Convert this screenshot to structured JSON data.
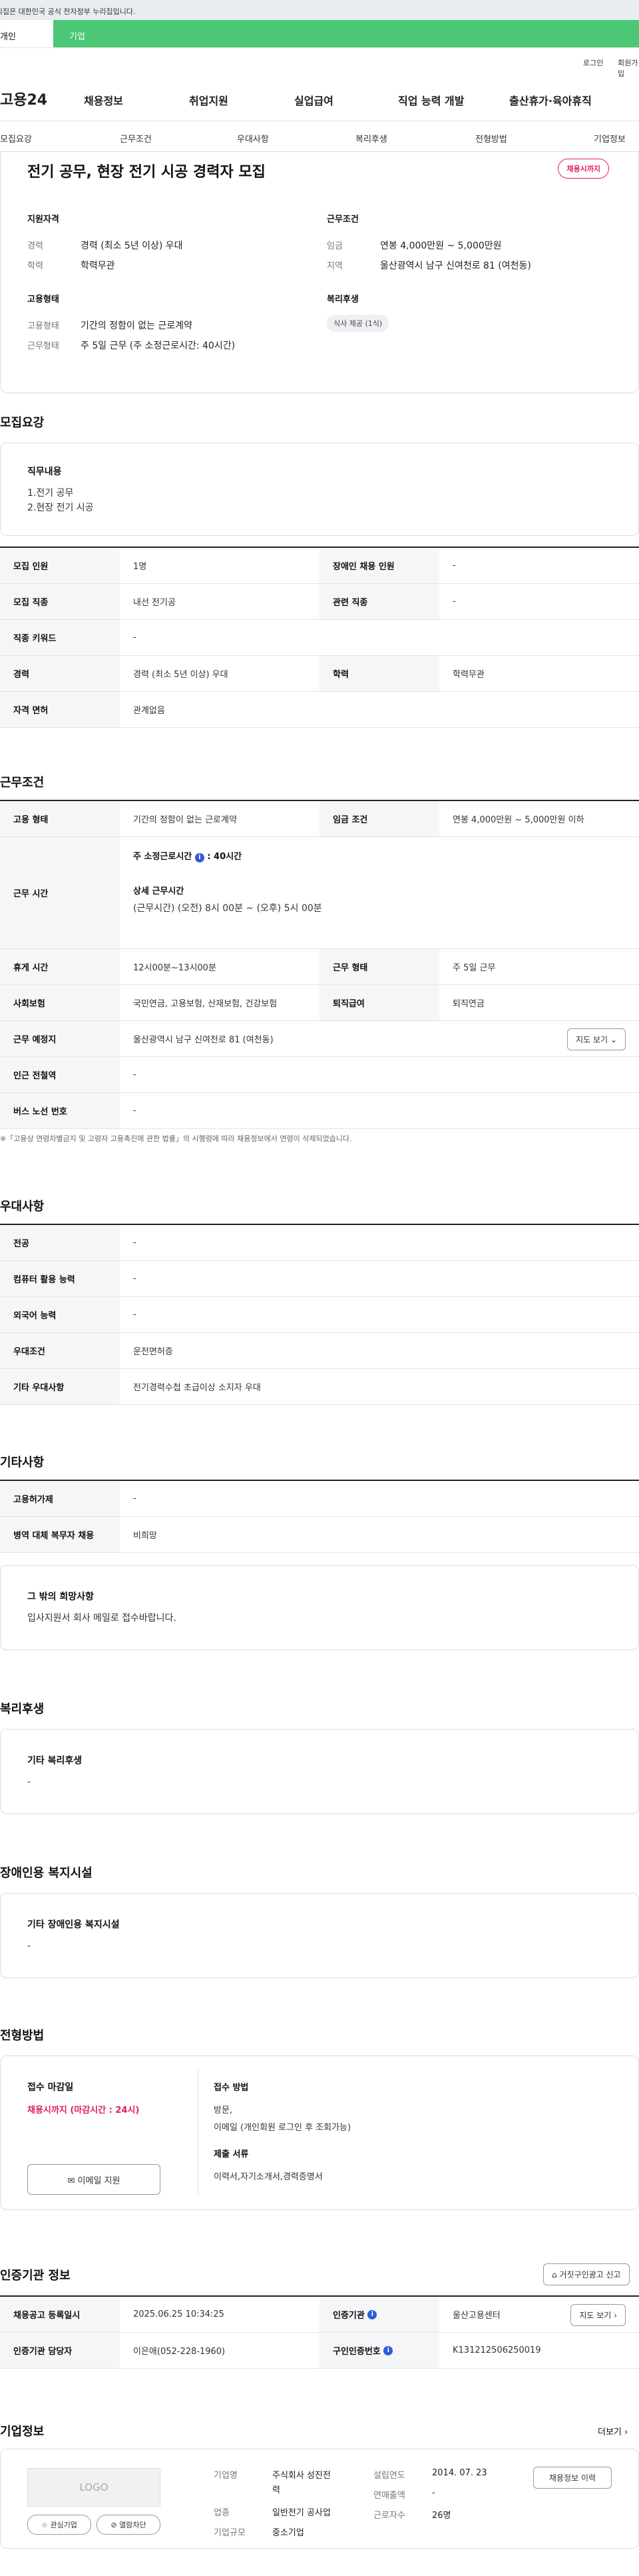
{
  "notice": "이 누리집은 대한민국 공식 전자정부 누리집입니다.",
  "usertabs": [
    "개인",
    "기업"
  ],
  "util": [
    "로그인",
    "회원가입"
  ],
  "gnb": {
    "logo": "고용24",
    "menu": [
      "채용정보",
      "취업지원",
      "실업급여",
      "직업 능력 개발",
      "출산휴가·육아휴직"
    ]
  },
  "tabs": [
    "모집요강",
    "근무조건",
    "우대사항",
    "복리후생",
    "전형방법",
    "기업정보"
  ],
  "job": {
    "title": "전기 공무, 현장 전기 시공 경력자 모집",
    "badge": "채용시까지",
    "req_title": "지원자격",
    "req_k": [
      "경력",
      "학력"
    ],
    "req_v": [
      "경력 (최소 5년 이상) 우대",
      "학력무관"
    ],
    "cond_title": "근무조건",
    "cond_k": [
      "임금",
      "지역"
    ],
    "cond_v": [
      "연봉 4,000만원 ~ 5,000만원",
      "울산광역시 남구 신여천로 81 (여천동)"
    ],
    "emp_title": "고용형태",
    "emp_k": [
      "고용형태",
      "근무형태"
    ],
    "emp_v": [
      "기간의 정함이 없는 근로계약",
      "주 5일 근무 (주 소정근로시간: 40시간)"
    ],
    "welfare_title": "복리후생",
    "welfare_tag": "식사 제공 (1식)"
  },
  "s1": {
    "title": "모집요강",
    "box_title": "직무내용",
    "box_lines": [
      "1.전기 공무",
      "2.현장 전기 시공"
    ],
    "rows": [
      [
        "모집 인원",
        "1명",
        "장애인 채용 인원",
        "-"
      ],
      [
        "모집 직종",
        "내선 전기공",
        "관련 직종",
        "-"
      ],
      [
        "직종 키워드",
        "-"
      ],
      [
        "경력",
        "경력 (최소 5년 이상) 우대",
        "학력",
        "학력무관"
      ],
      [
        "자격 면허",
        "관계없음"
      ]
    ]
  },
  "s2": {
    "title": "근무조건",
    "r1": [
      "고용 형태",
      "기간의 정함이 없는 근로계약",
      "임금 조건",
      "연봉 4,000만원 ~ 5,000만원 이하"
    ],
    "time_k": "근무 시간",
    "time_a": "주 소정근로시간",
    "time_b": "40시간",
    "time_c": "상세 근무시간",
    "time_d": "(근무시간) (오전) 8시 00분 ~ (오후) 5시 00분",
    "rows": [
      [
        "휴게 시간",
        "12시00분~13시00분",
        "근무 형태",
        "주 5일 근무"
      ],
      [
        "사회보험",
        "국민연금, 고용보험, 산재보험, 건강보험",
        "퇴직급여",
        "퇴직연금"
      ]
    ],
    "place": [
      "근무 예정지",
      "울산광역시 남구 신여천로 81 (여천동)"
    ],
    "map_btn": "지도 보기",
    "rows2": [
      [
        "인근 전철역",
        "-"
      ],
      [
        "버스 노선 번호",
        "-"
      ]
    ],
    "note": "※「고용상 연령차별금지 및 고령자 고용촉진에 관한 법률」의 시행령에 따라 채용정보에서 연령이 삭제되었습니다."
  },
  "s3": {
    "title": "우대사항",
    "rows": [
      [
        "전공",
        "-"
      ],
      [
        "컴퓨터 활용 능력",
        "-"
      ],
      [
        "외국어 능력",
        "-"
      ],
      [
        "우대조건",
        "운전면허증"
      ],
      [
        "기타 우대사항",
        "전기경력수첩 초급이상 소지자 우대"
      ]
    ]
  },
  "s4": {
    "title": "기타사항",
    "rows": [
      [
        "고용허가제",
        "-"
      ],
      [
        "병역 대체 복무자 채용",
        "비희망"
      ]
    ],
    "box_title": "그 밖의 희망사항",
    "box_text": "입사지원서 회사 메일로 접수바랍니다."
  },
  "s5": {
    "title": "복리후생",
    "box_title": "기타 복리후생",
    "box_text": "-"
  },
  "s6": {
    "title": "장애인용 복지시설",
    "box_title": "기타 장애인용 복지시설",
    "box_text": "-"
  },
  "s7": {
    "title": "전형방법",
    "deadline_k": "접수 마감일",
    "deadline_v": "채용시까지 (마감시간 : 24시)",
    "email_btn": "이메일 지원",
    "method_k": "접수 방법",
    "method_v1": "방문,",
    "method_v2": "이메일 (개인회원 로그인 후 조회가능)",
    "docs_k": "제출 서류",
    "docs_v": "이력서,자기소개서,경력증명서"
  },
  "s8": {
    "title": "인증기관 정보",
    "report": "거짓구인광고 신고",
    "r1": [
      "채용공고 등록일시",
      "2025.06.25 10:34:25",
      "인증기관",
      "울산고용센터"
    ],
    "map_btn": "지도 보기",
    "r2": [
      "인증기관 담당자",
      "이은애(052-228-1960)",
      "구인인증번호",
      "K131212506250019"
    ]
  },
  "s9": {
    "title": "기업정보",
    "more": "더보기",
    "logo": "LOGO",
    "fav": "관심기업",
    "block": "열람차단",
    "k1": "기업명",
    "v1a": "주식회사 성진전",
    "v1b": "력",
    "k2": "업종",
    "v2": "일반전기 공사업",
    "k3": "기업규모",
    "v3": "중소기업",
    "k4": "설립연도",
    "v4": "2014. 07. 23",
    "k5": "연매출액",
    "v5": "-",
    "k6": "근로자수",
    "v6": "26명",
    "hist": "채용정보 이력"
  }
}
